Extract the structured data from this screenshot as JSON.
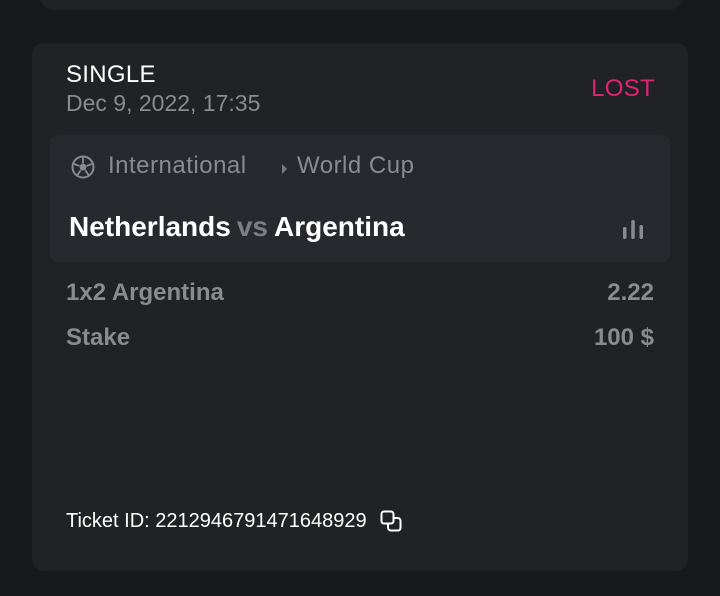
{
  "bet": {
    "type": "SINGLE",
    "date": "Dec 9, 2022, 17:35",
    "status": "LOST",
    "status_color": "#e0246e"
  },
  "event": {
    "sport_icon": "soccer-ball-icon",
    "league": "International",
    "tournament": "World Cup",
    "home_team": "Netherlands",
    "vs": "vs",
    "away_team": "Argentina",
    "stats_icon": "bar-chart-icon"
  },
  "selection": {
    "label": "1x2 Argentina",
    "odds": "2.22"
  },
  "stake": {
    "label": "Stake",
    "value": "100 $"
  },
  "ticket": {
    "text": "Ticket ID: 2212946791471648929",
    "copy_icon": "copy-icon"
  }
}
